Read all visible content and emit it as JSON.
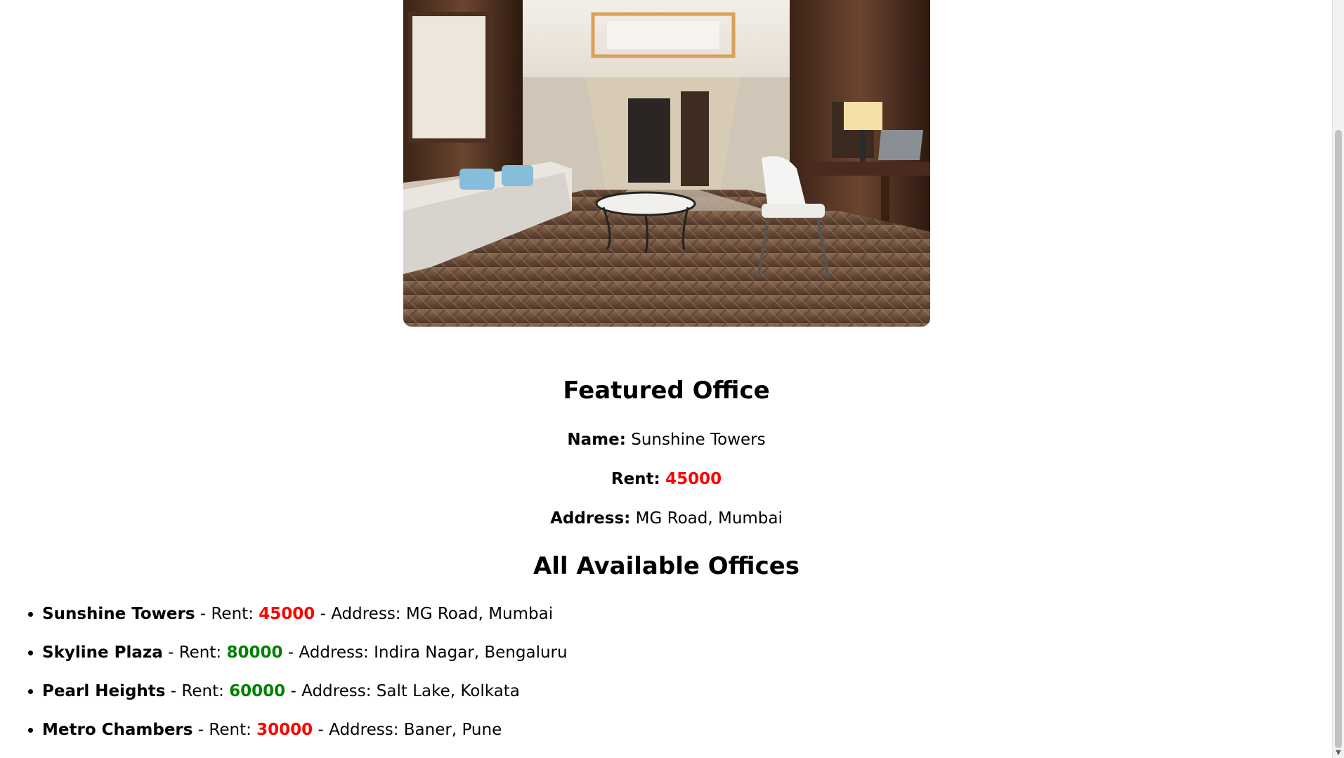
{
  "featured": {
    "title": "Featured Office",
    "name_label": "Name:",
    "name": "Sunshine Towers",
    "rent_label": "Rent:",
    "rent": "45000",
    "address_label": "Address:",
    "address": "MG Road, Mumbai"
  },
  "all_offices": {
    "title": "All Available Offices",
    "rent_prefix": "Rent:",
    "address_prefix": "Address:",
    "items": [
      {
        "name": "Sunshine Towers",
        "rent": "45000",
        "rent_status": "red",
        "address": "MG Road, Mumbai"
      },
      {
        "name": "Skyline Plaza",
        "rent": "80000",
        "rent_status": "green",
        "address": "Indira Nagar, Bengaluru"
      },
      {
        "name": "Pearl Heights",
        "rent": "60000",
        "rent_status": "green",
        "address": "Salt Lake, Kolkata"
      },
      {
        "name": "Metro Chambers",
        "rent": "30000",
        "rent_status": "red",
        "address": "Baner, Pune"
      }
    ]
  },
  "colors": {
    "rent_low": "#ff0000",
    "rent_high": "#008000"
  },
  "icons": {
    "scroll_down": "chevron-down-icon"
  }
}
